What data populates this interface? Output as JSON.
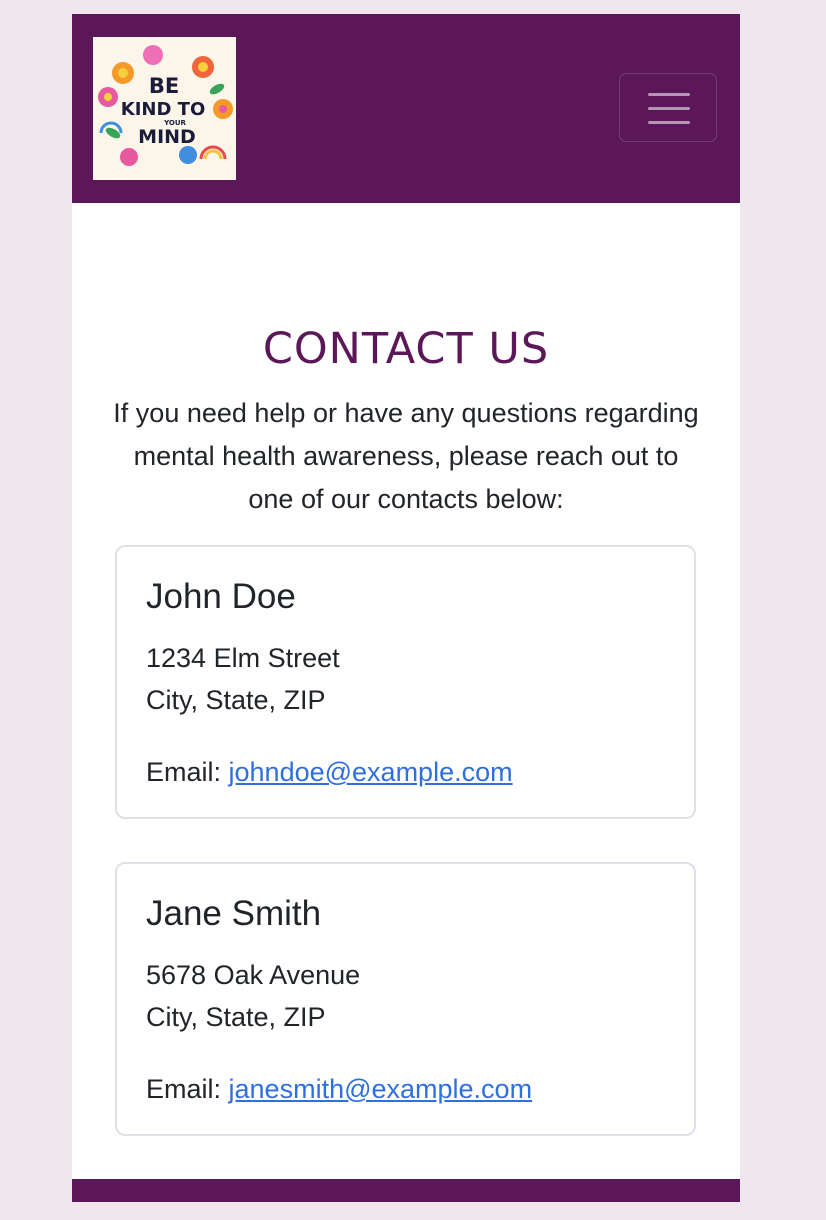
{
  "brand": {
    "logo_text_line1": "BE",
    "logo_text_line2": "KIND TO",
    "logo_text_line3": "YOUR",
    "logo_text_line4": "MIND",
    "brand_color": "#5c1759"
  },
  "navbar": {
    "toggler_icon": "hamburger-menu-icon"
  },
  "main": {
    "title": "CONTACT US",
    "intro": "If you need help or have any questions regarding mental health awareness, please reach out to one of our contacts below:"
  },
  "contacts": [
    {
      "name": "John Doe",
      "address_line1": "1234 Elm Street",
      "address_line2": "City, State, ZIP",
      "email_label": "Email:",
      "email": "johndoe@example.com"
    },
    {
      "name": "Jane Smith",
      "address_line1": "5678 Oak Avenue",
      "address_line2": "City, State, ZIP",
      "email_label": "Email:",
      "email": "janesmith@example.com"
    }
  ],
  "colors": {
    "accent": "#5c1759",
    "link": "#2f6fe0",
    "page_background": "#efe6ee"
  }
}
